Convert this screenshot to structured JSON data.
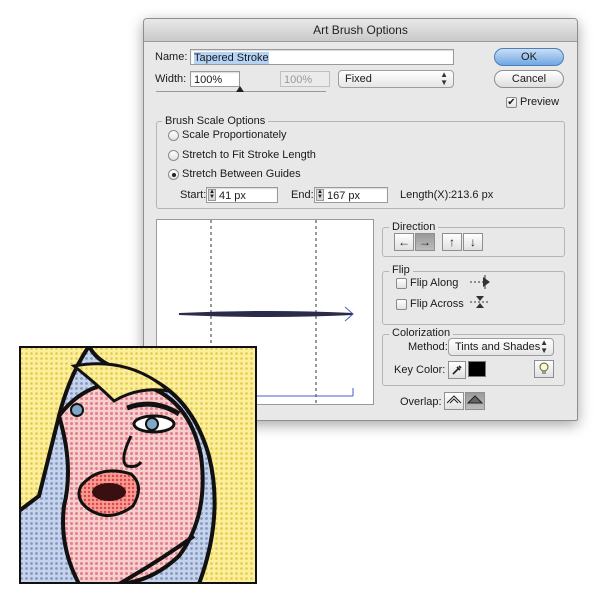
{
  "dialog": {
    "title": "Art Brush Options",
    "name_label": "Name:",
    "name_value": "Tapered Stroke",
    "width_label": "Width:",
    "width_value": "100%",
    "width_max_value": "100%",
    "width_mode": "Fixed",
    "ok_label": "OK",
    "cancel_label": "Cancel",
    "preview_label": "Preview",
    "preview_checked": true,
    "scale": {
      "title": "Brush Scale Options",
      "options": [
        "Scale Proportionately",
        "Stretch to Fit Stroke Length",
        "Stretch Between Guides"
      ],
      "selected": 2,
      "start_label": "Start:",
      "start_value": "41 px",
      "end_label": "End:",
      "end_value": "167 px",
      "length_label": "Length(X):",
      "length_value": "213.6 px"
    },
    "direction": {
      "title": "Direction",
      "buttons": [
        "←",
        "→",
        "↑",
        "↓"
      ],
      "selected": 1
    },
    "flip": {
      "title": "Flip",
      "along_label": "Flip Along",
      "across_label": "Flip Across"
    },
    "colorization": {
      "title": "Colorization",
      "method_label": "Method:",
      "method_value": "Tints and Shades",
      "key_color_label": "Key Color:",
      "key_color": "#000000"
    },
    "overlap_label": "Overlap:"
  },
  "colors": {
    "dialog_bg": "#e8e8e8",
    "selection_highlight": "#b4d3f5",
    "default_button": "#6fa7e4",
    "stroke": "#2b2b4a",
    "guide_arrow": "#4a5ec8",
    "comic_skin": "#f3b7b9",
    "comic_hair": "#f6e38a",
    "comic_bg": "#a9bbd9",
    "comic_lips": "#f26d6d"
  },
  "artwork": {
    "subject": "pop-art-comic-woman-illustration"
  }
}
